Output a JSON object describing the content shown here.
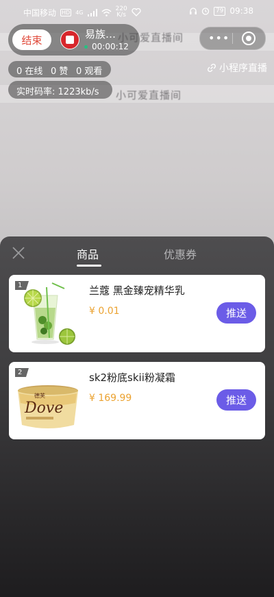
{
  "status_bar": {
    "carrier": "中国移动",
    "hd_badge": "HD",
    "signal_type": "4G",
    "net_speed_value": "220",
    "net_speed_unit": "K/s",
    "battery": "79",
    "time": "09:38"
  },
  "background": {
    "watermark_text_1": "小可爱直播间",
    "watermark_text_2": "小可爱直播间"
  },
  "host": {
    "end_label": "结束",
    "name": "易族…",
    "timer": "00:00:12"
  },
  "capsule": {
    "more_label": "•••"
  },
  "stats": {
    "online": "0 在线",
    "likes": "0 赞",
    "views": "0 观看",
    "bitrate_label": "实时码率:",
    "bitrate_value": "1223kb/s"
  },
  "mini_program_live_label": "小程序直播",
  "sheet": {
    "tabs": [
      {
        "label": "商品",
        "active": true
      },
      {
        "label": "优惠券",
        "active": false
      }
    ],
    "products": [
      {
        "index": "1",
        "title": "兰蔻 黑金臻宠精华乳",
        "price": "¥ 0.01",
        "push_label": "推送",
        "thumb_icon": "mojito-drink-icon"
      },
      {
        "index": "2",
        "title": "sk2粉底skii粉凝霜",
        "price": "¥ 169.99",
        "push_label": "推送",
        "thumb_icon": "dove-chocolate-icon",
        "thumb_brand_cn": "德芙",
        "thumb_brand": "Dove"
      }
    ]
  },
  "colors": {
    "accent_purple": "#6b5ce7",
    "price_orange": "#eba230",
    "end_red": "#e04a3b"
  }
}
